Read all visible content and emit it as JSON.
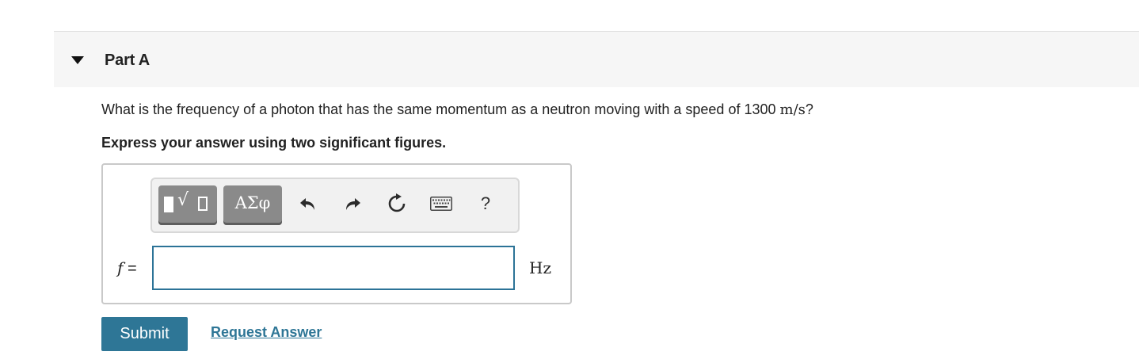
{
  "part": {
    "title": "Part A"
  },
  "question": {
    "prefix": "What is the frequency of a photon that has the same momentum as a neutron moving with a speed of 1300 ",
    "unit_math": "m/s",
    "suffix": "?",
    "instruction": "Express your answer using two significant figures."
  },
  "toolbar": {
    "greek_label": "ΑΣφ",
    "help_label": "?",
    "icons": [
      "templates-icon",
      "greek-letters-icon",
      "undo-icon",
      "redo-icon",
      "reset-icon",
      "keyboard-icon",
      "help-icon"
    ]
  },
  "answer": {
    "variable": "f",
    "equals": "=",
    "value": "",
    "unit": "Hz"
  },
  "actions": {
    "submit_label": "Submit",
    "request_label": "Request Answer"
  },
  "colors": {
    "accent": "#2e7696",
    "input_border": "#2c7397",
    "header_bg": "#f6f6f6",
    "toolbar_button": "#8a8a8a"
  }
}
